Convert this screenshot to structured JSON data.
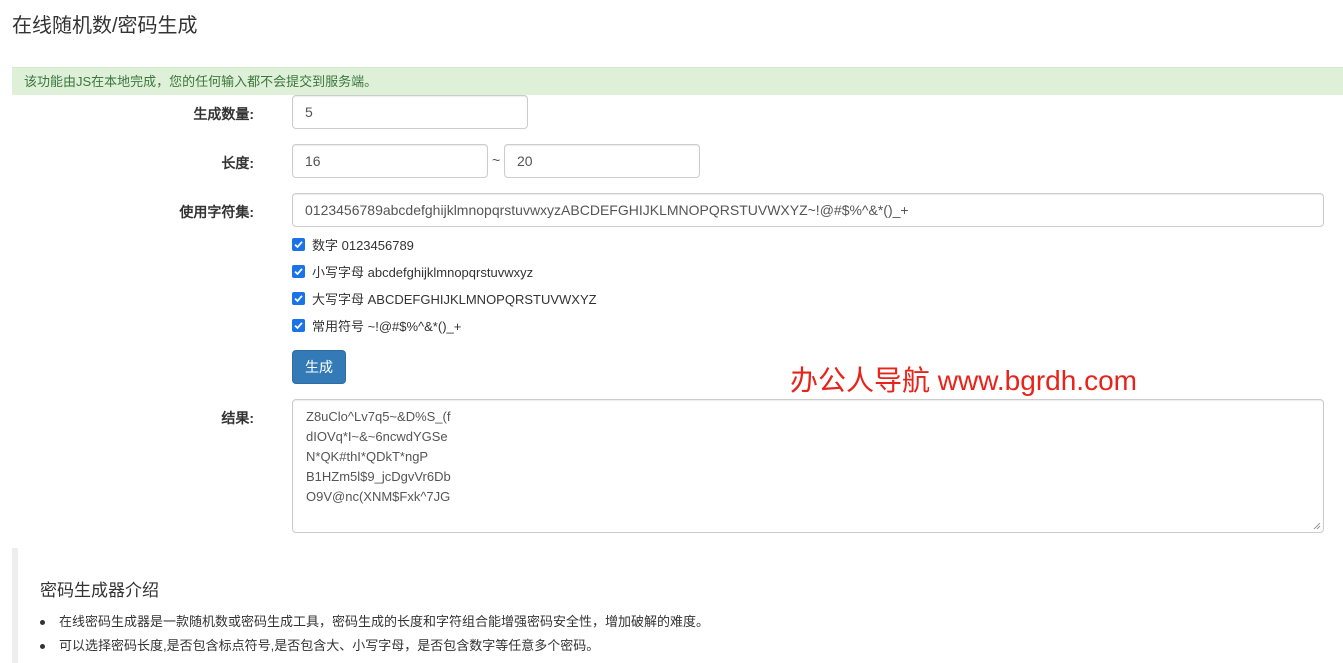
{
  "page": {
    "title": "在线随机数/密码生成",
    "notice": "该功能由JS在本地完成，您的任何输入都不会提交到服务端。"
  },
  "form": {
    "count_label": "生成数量:",
    "count_value": "5",
    "length_label": "长度:",
    "length_min": "16",
    "length_separator": "~",
    "length_max": "20",
    "charset_label": "使用字符集:",
    "charset_value": "0123456789abcdefghijklmnopqrstuvwxyzABCDEFGHIJKLMNOPQRSTUVWXYZ~!@#$%^&*()_+",
    "options": [
      {
        "label": "数字 0123456789",
        "checked": true
      },
      {
        "label": "小写字母 abcdefghijklmnopqrstuvwxyz",
        "checked": true
      },
      {
        "label": "大写字母 ABCDEFGHIJKLMNOPQRSTUVWXYZ",
        "checked": true
      },
      {
        "label": "常用符号 ~!@#$%^&*()_+",
        "checked": true
      }
    ],
    "generate_label": "生成",
    "result_label": "结果:",
    "results": [
      "Z8uClo^Lv7q5~&D%S_(f",
      "dIOVq*I~&~6ncwdYGSe",
      "N*QK#thI*QDkT*ngP",
      "B1HZm5l$9_jcDgvVr6Db",
      "O9V@nc(XNM$Fxk^7JG"
    ]
  },
  "watermark": "办公人导航 www.bgrdh.com",
  "intro": {
    "title": "密码生成器介绍",
    "items": [
      "在线密码生成器是一款随机数或密码生成工具，密码生成的长度和字符组合能增强密码安全性，增加破解的难度。",
      "可以选择密码长度,是否包含标点符号,是否包含大、小写字母，是否包含数字等任意多个密码。"
    ]
  },
  "colors": {
    "primary": "#337ab7",
    "notice_bg": "#dff0d8",
    "notice_text": "#3c763d",
    "checkbox": "#1a73e8",
    "watermark": "#e8231a"
  }
}
